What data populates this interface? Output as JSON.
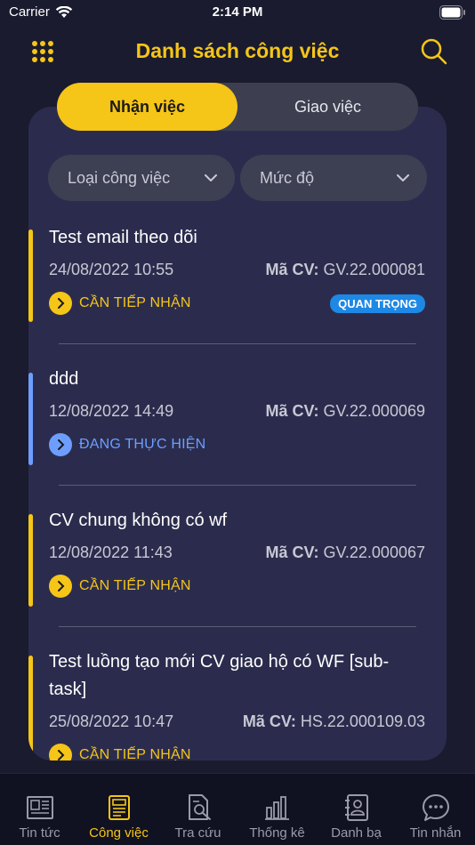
{
  "status_bar": {
    "carrier": "Carrier",
    "time": "2:14 PM"
  },
  "header": {
    "title": "Danh sách công việc"
  },
  "segments": [
    {
      "label": "Nhận việc",
      "active": true
    },
    {
      "label": "Giao việc",
      "active": false
    }
  ],
  "filters": [
    {
      "label": "Loại công việc"
    },
    {
      "label": "Mức độ"
    }
  ],
  "code_label": "Mã CV:",
  "tasks": [
    {
      "title": "Test email theo dõi",
      "date": "24/08/2022 10:55",
      "code": "GV.22.000081",
      "status": "CẦN TIẾP NHẬN",
      "status_color": "#f5c518",
      "badge": "QUAN TRỌNG"
    },
    {
      "title": "ddd",
      "date": "12/08/2022 14:49",
      "code": "GV.22.000069",
      "status": "ĐANG THỰC HIỆN",
      "status_color": "#6d9eff",
      "badge": ""
    },
    {
      "title": "CV chung không có wf",
      "date": "12/08/2022 11:43",
      "code": "GV.22.000067",
      "status": "CẦN TIẾP NHẬN",
      "status_color": "#f5c518",
      "badge": ""
    },
    {
      "title": "Test luồng tạo mới CV giao hộ có WF [sub-task]",
      "date": "25/08/2022 10:47",
      "code": "HS.22.000109.03",
      "status": "CẦN TIẾP NHẬN",
      "status_color": "#f5c518",
      "badge": ""
    }
  ],
  "tabs": [
    {
      "label": "Tin tức",
      "icon": "newspaper-icon",
      "active": false
    },
    {
      "label": "Công việc",
      "icon": "tasks-icon",
      "active": true
    },
    {
      "label": "Tra cứu",
      "icon": "document-search-icon",
      "active": false
    },
    {
      "label": "Thống kê",
      "icon": "bar-chart-icon",
      "active": false
    },
    {
      "label": "Danh bạ",
      "icon": "contacts-icon",
      "active": false
    },
    {
      "label": "Tin nhắn",
      "icon": "chat-icon",
      "active": false
    }
  ],
  "colors": {
    "accent": "#f5c518",
    "in_progress": "#6d9eff",
    "badge": "#1e88e5"
  }
}
